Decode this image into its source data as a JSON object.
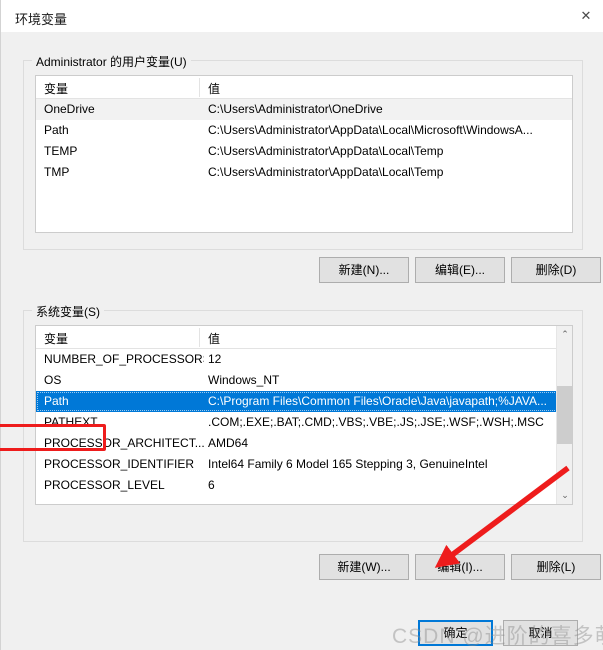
{
  "window": {
    "title": "环境变量",
    "close_icon": "close-icon",
    "close_glyph": "✕"
  },
  "user_section": {
    "legend": "Administrator 的用户变量(U)",
    "columns": [
      "变量",
      "值"
    ],
    "rows": [
      {
        "name": "OneDrive",
        "value": "C:\\Users\\Administrator\\OneDrive",
        "selected": false,
        "alt": true
      },
      {
        "name": "Path",
        "value": "C:\\Users\\Administrator\\AppData\\Local\\Microsoft\\WindowsA...",
        "selected": false,
        "alt": false
      },
      {
        "name": "TEMP",
        "value": "C:\\Users\\Administrator\\AppData\\Local\\Temp",
        "selected": false,
        "alt": false
      },
      {
        "name": "TMP",
        "value": "C:\\Users\\Administrator\\AppData\\Local\\Temp",
        "selected": false,
        "alt": false
      }
    ],
    "buttons": {
      "new": "新建(N)...",
      "edit": "编辑(E)...",
      "delete": "删除(D)"
    }
  },
  "system_section": {
    "legend": "系统变量(S)",
    "columns": [
      "变量",
      "值"
    ],
    "rows": [
      {
        "name": "NUMBER_OF_PROCESSORS",
        "value": "12",
        "selected": false
      },
      {
        "name": "OS",
        "value": "Windows_NT",
        "selected": false
      },
      {
        "name": "Path",
        "value": "C:\\Program Files\\Common Files\\Oracle\\Java\\javapath;%JAVA...",
        "selected": true
      },
      {
        "name": "PATHEXT",
        "value": ".COM;.EXE;.BAT;.CMD;.VBS;.VBE;.JS;.JSE;.WSF;.WSH;.MSC",
        "selected": false
      },
      {
        "name": "PROCESSOR_ARCHITECT...",
        "value": "AMD64",
        "selected": false
      },
      {
        "name": "PROCESSOR_IDENTIFIER",
        "value": "Intel64 Family 6 Model 165 Stepping 3, GenuineIntel",
        "selected": false
      },
      {
        "name": "PROCESSOR_LEVEL",
        "value": "6",
        "selected": false
      }
    ],
    "buttons": {
      "new": "新建(W)...",
      "edit": "编辑(I)...",
      "delete": "删除(L)"
    },
    "scrollbar": {
      "up_glyph": "⌃",
      "down_glyph": "⌄"
    }
  },
  "dialog_buttons": {
    "ok": "确定",
    "cancel": "取消"
  },
  "annotations": {
    "highlight_target": "Path",
    "arrow_target": "编辑(I)...",
    "accent_color": "#ee1c1c",
    "selection_color": "#0078d7"
  },
  "watermark": {
    "text": "CSDN @进阶的喜多萌~"
  }
}
